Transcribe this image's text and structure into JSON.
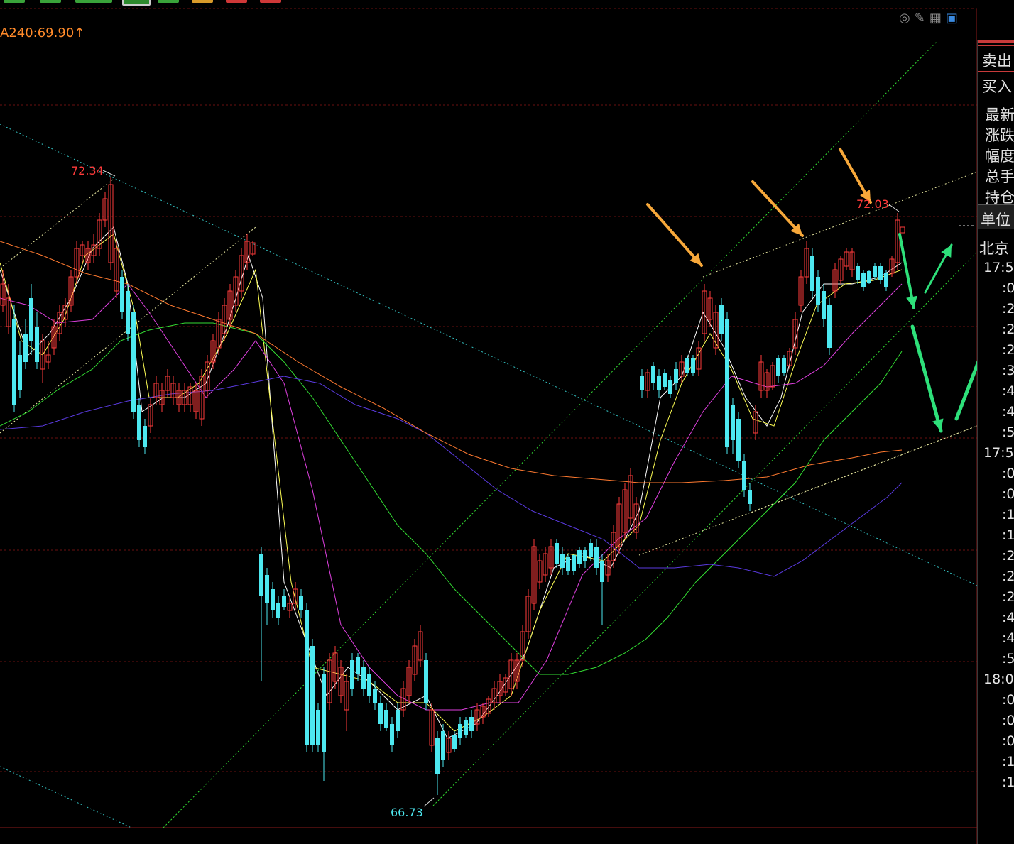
{
  "indicator": {
    "ma_label": "A240:69.90",
    "arrow": "↑"
  },
  "toolbar_colors": [
    "#3aa33a",
    "#3aa33a",
    "#3aa33a",
    "#3aa33a",
    "#2d8a2d",
    "#3aa33a",
    "#d89a2a",
    "#d03838",
    "#d03838"
  ],
  "top_icons": [
    "eye-off-icon",
    "pencil-icon",
    "grid-icon",
    "window-icon"
  ],
  "side_panel": {
    "sell": "卖出",
    "buy": "买入",
    "stats": [
      "最新",
      "涨跌",
      "幅度",
      "总手",
      "持仓"
    ],
    "unit": "单位",
    "city": "北京",
    "times": [
      {
        "main": "17:5",
        "subs": [
          ":0",
          ":2",
          ":2",
          ":2",
          ":3",
          ":4",
          ":4",
          ":5"
        ]
      },
      {
        "main": "17:5",
        "subs": [
          ":0",
          ":0",
          ":1",
          ":1",
          ":2",
          ":2",
          ":2",
          ":4",
          ":4",
          ":5"
        ]
      },
      {
        "main": "18:0",
        "subs": [
          ":0",
          ":0",
          ":0",
          ":1",
          ":1"
        ]
      }
    ]
  },
  "chart_data": {
    "type": "candlestick",
    "annotations": [
      {
        "label": "72.34",
        "kind": "high",
        "color": "#ff3b3b"
      },
      {
        "label": "72.03",
        "kind": "high",
        "color": "#ff3b3b"
      },
      {
        "label": "66.73",
        "kind": "low",
        "color": "#4de8f0"
      }
    ],
    "moving_averages": [
      {
        "color": "#ffffff"
      },
      {
        "color": "#ffff55"
      },
      {
        "color": "#e040e0"
      },
      {
        "color": "#33dd33"
      },
      {
        "color": "#5a3ae0"
      },
      {
        "color": "#ff7a30"
      }
    ],
    "colors": {
      "up": "#ff3b3b",
      "down": "#4de8f0",
      "gridline": "#6a1010",
      "trendline": "#33dd33",
      "channel": "#e8e8a0",
      "downtrend": "#33c0c0",
      "orange_arrow": "#f7a83a",
      "green_arrow": "#2ee07a"
    }
  }
}
